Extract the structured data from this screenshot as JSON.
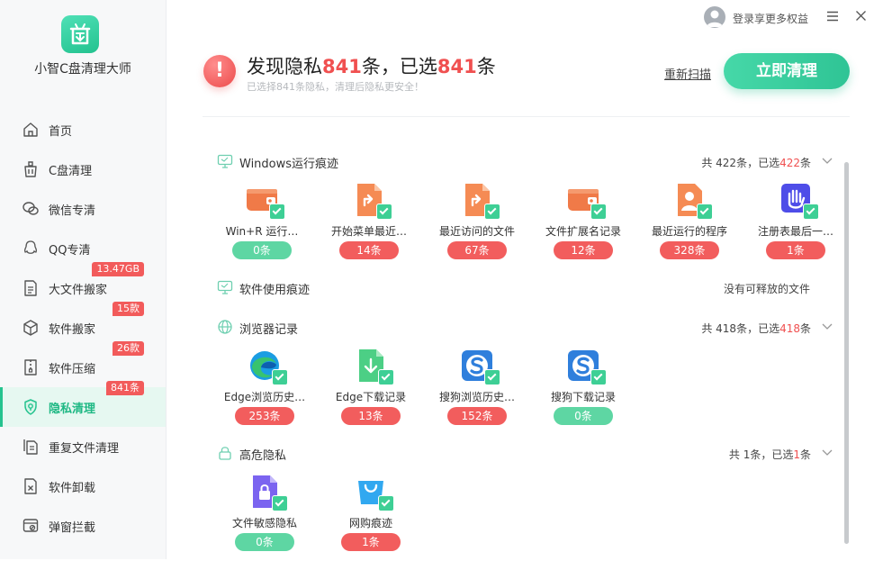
{
  "app": {
    "name": "小智C盘清理大师"
  },
  "colors": {
    "accent": "#2fc495",
    "danger": "#f05050"
  },
  "topbar": {
    "login_text": "登录享更多权益",
    "menu_icon": "menu-icon",
    "close_icon": "close-icon"
  },
  "sidebar": {
    "items": [
      {
        "label": "首页",
        "icon": "home-icon",
        "badge": ""
      },
      {
        "label": "C盘清理",
        "icon": "c-drive-clean-icon",
        "badge": ""
      },
      {
        "label": "微信专清",
        "icon": "wechat-icon",
        "badge": ""
      },
      {
        "label": "QQ专清",
        "icon": "qq-icon",
        "badge": ""
      },
      {
        "label": "大文件搬家",
        "icon": "big-file-icon",
        "badge": "13.47GB"
      },
      {
        "label": "软件搬家",
        "icon": "software-move-icon",
        "badge": "15款"
      },
      {
        "label": "软件压缩",
        "icon": "compress-icon",
        "badge": "26款"
      },
      {
        "label": "隐私清理",
        "icon": "privacy-icon",
        "badge": "841条",
        "active": true
      },
      {
        "label": "重复文件清理",
        "icon": "duplicate-file-icon",
        "badge": ""
      },
      {
        "label": "软件卸载",
        "icon": "uninstall-icon",
        "badge": ""
      },
      {
        "label": "弹窗拦截",
        "icon": "popup-block-icon",
        "badge": ""
      }
    ]
  },
  "header": {
    "alert_icon": "!",
    "title_prefix": "发现隐私",
    "found_count": "841",
    "title_middle": "条，已选",
    "selected_count": "841",
    "title_suffix": "条",
    "subtitle": "已选择841条隐私，清理后隐私更安全！",
    "rescan_label": "重新扫描",
    "clean_label": "立即清理"
  },
  "sections": [
    {
      "title": "Windows运行痕迹",
      "icon": "monitor-icon",
      "summary": {
        "prefix": "共 422条，已选",
        "selected": "422",
        "suffix": "条"
      },
      "items": [
        {
          "name": "Win+R 运行…",
          "count": "0条",
          "icon": "wallet-icon"
        },
        {
          "name": "开始菜单最近…",
          "count": "14条",
          "icon": "shortcut-file-icon"
        },
        {
          "name": "最近访问的文件",
          "count": "67条",
          "icon": "shortcut-file-icon"
        },
        {
          "name": "文件扩展名记录",
          "count": "12条",
          "icon": "wallet-icon"
        },
        {
          "name": "最近运行的程序",
          "count": "328条",
          "icon": "user-card-icon"
        },
        {
          "name": "注册表最后一…",
          "count": "1条",
          "icon": "hand-icon"
        }
      ]
    },
    {
      "title": "软件使用痕迹",
      "icon": "monitor-icon",
      "empty_text": "没有可释放的文件"
    },
    {
      "title": "浏览器记录",
      "icon": "globe-icon",
      "summary": {
        "prefix": "共 418条，已选",
        "selected": "418",
        "suffix": "条"
      },
      "items": [
        {
          "name": "Edge浏览历史…",
          "count": "253条",
          "icon": "edge-icon"
        },
        {
          "name": "Edge下载记录",
          "count": "13条",
          "icon": "download-file-icon"
        },
        {
          "name": "搜狗浏览历史…",
          "count": "152条",
          "icon": "sogou-icon"
        },
        {
          "name": "搜狗下载记录",
          "count": "0条",
          "icon": "sogou-icon"
        }
      ]
    },
    {
      "title": "高危隐私",
      "icon": "lock-icon",
      "summary": {
        "prefix": "共 1条，已选",
        "selected": "1",
        "suffix": "条"
      },
      "items": [
        {
          "name": "文件敏感隐私",
          "count": "0条",
          "icon": "locked-file-icon"
        },
        {
          "name": "网购痕迹",
          "count": "1条",
          "icon": "shopping-bag-icon"
        }
      ]
    }
  ]
}
